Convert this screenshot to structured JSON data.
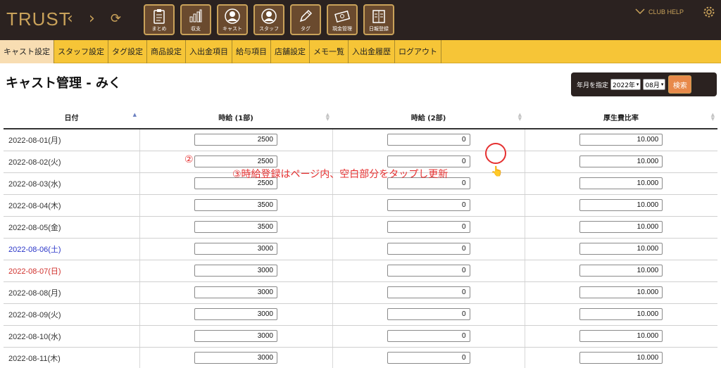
{
  "app": {
    "logo": "TRUST",
    "back_icon": "chevron-left-icon",
    "forward_icon": "chevron-right-icon",
    "reload_icon": "reload-icon",
    "club_help": "CLUB HELP",
    "settings_icon": "gear-icon"
  },
  "nav_buttons": [
    {
      "label": "まとめ",
      "icon": "clipboard-icon"
    },
    {
      "label": "収支",
      "icon": "bar-chart-icon"
    },
    {
      "label": "キャスト",
      "icon": "person-icon"
    },
    {
      "label": "スタッフ",
      "icon": "person-icon"
    },
    {
      "label": "タグ",
      "icon": "pen-icon"
    },
    {
      "label": "現金管理",
      "icon": "cash-icon"
    },
    {
      "label": "日報登録",
      "icon": "book-icon"
    }
  ],
  "submenu": [
    {
      "label": "キャスト設定",
      "active": true
    },
    {
      "label": "スタッフ設定"
    },
    {
      "label": "タグ設定"
    },
    {
      "label": "商品設定"
    },
    {
      "label": "入出金項目"
    },
    {
      "label": "給与項目"
    },
    {
      "label": "店舗設定"
    },
    {
      "label": "メモ一覧"
    },
    {
      "label": "入出金履歴"
    },
    {
      "label": "ログアウト"
    }
  ],
  "page": {
    "title": "キャスト管理 - みく"
  },
  "filter": {
    "label": "年月を指定",
    "year": "2022年",
    "month": "08月",
    "search_label": "検索"
  },
  "table": {
    "headers": [
      "日付",
      "時給 (1部)",
      "時給 (2部)",
      "厚生費比率"
    ],
    "rows": [
      {
        "date": "2022-08-01(月)",
        "rate1": "2500",
        "rate2": "0",
        "welfare": "10.000",
        "day_type": "weekday"
      },
      {
        "date": "2022-08-02(火)",
        "rate1": "2500",
        "rate2": "0",
        "welfare": "10.000",
        "day_type": "weekday"
      },
      {
        "date": "2022-08-03(水)",
        "rate1": "2500",
        "rate2": "0",
        "welfare": "10.000",
        "day_type": "weekday"
      },
      {
        "date": "2022-08-04(木)",
        "rate1": "3500",
        "rate2": "0",
        "welfare": "10.000",
        "day_type": "weekday"
      },
      {
        "date": "2022-08-05(金)",
        "rate1": "3500",
        "rate2": "0",
        "welfare": "10.000",
        "day_type": "weekday"
      },
      {
        "date": "2022-08-06(土)",
        "rate1": "3000",
        "rate2": "0",
        "welfare": "10.000",
        "day_type": "saturday"
      },
      {
        "date": "2022-08-07(日)",
        "rate1": "3000",
        "rate2": "0",
        "welfare": "10.000",
        "day_type": "sunday"
      },
      {
        "date": "2022-08-08(月)",
        "rate1": "3000",
        "rate2": "0",
        "welfare": "10.000",
        "day_type": "weekday"
      },
      {
        "date": "2022-08-09(火)",
        "rate1": "3000",
        "rate2": "0",
        "welfare": "10.000",
        "day_type": "weekday"
      },
      {
        "date": "2022-08-10(水)",
        "rate1": "3000",
        "rate2": "0",
        "welfare": "10.000",
        "day_type": "weekday"
      },
      {
        "date": "2022-08-11(木)",
        "rate1": "3000",
        "rate2": "0",
        "welfare": "10.000",
        "day_type": "weekday"
      }
    ]
  },
  "annotation": {
    "step_number": "②",
    "instruction": "③時給登録はページ内、空白部分をタップし更新",
    "hand_glyph": "👆"
  },
  "colors": {
    "topbar": "#2b2220",
    "gold": "#c9a25a",
    "submenu": "#f6c537",
    "submenu_active": "#f8ddb2",
    "search_button": "#e8894a",
    "saturday": "#2a35c8",
    "sunday": "#d0312d",
    "annotation": "#e53030"
  }
}
